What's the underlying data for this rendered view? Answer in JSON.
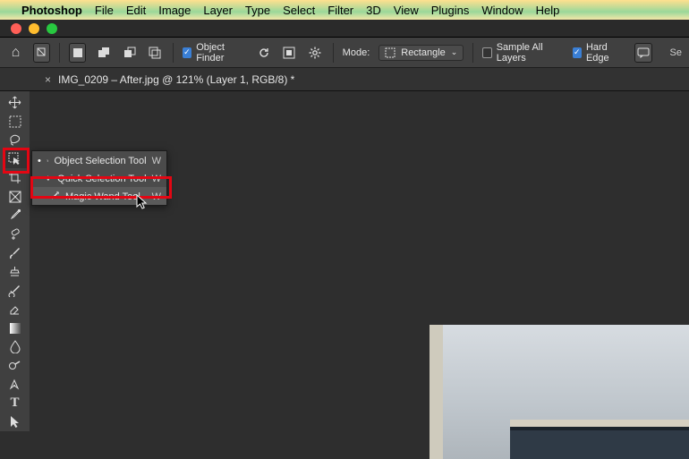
{
  "menubar": {
    "app": "Photoshop",
    "items": [
      "File",
      "Edit",
      "Image",
      "Layer",
      "Type",
      "Select",
      "Filter",
      "3D",
      "View",
      "Plugins",
      "Window",
      "Help"
    ]
  },
  "optionsBar": {
    "objectFinder": "Object Finder",
    "modeLabel": "Mode:",
    "modeValue": "Rectangle",
    "sampleAll": "Sample All Layers",
    "hardEdge": "Hard Edge",
    "selectSubjectHint": "Se"
  },
  "tab": {
    "close": "×",
    "title": "IMG_0209 – After.jpg @ 121% (Layer 1, RGB/8) *"
  },
  "flyout": {
    "rows": [
      {
        "bullet": "•",
        "label": "Object Selection Tool",
        "key": "W"
      },
      {
        "bullet": "",
        "label": "Quick Selection Tool",
        "key": "W"
      },
      {
        "bullet": "",
        "label": "Magic Wand Tool",
        "key": "W"
      }
    ]
  }
}
